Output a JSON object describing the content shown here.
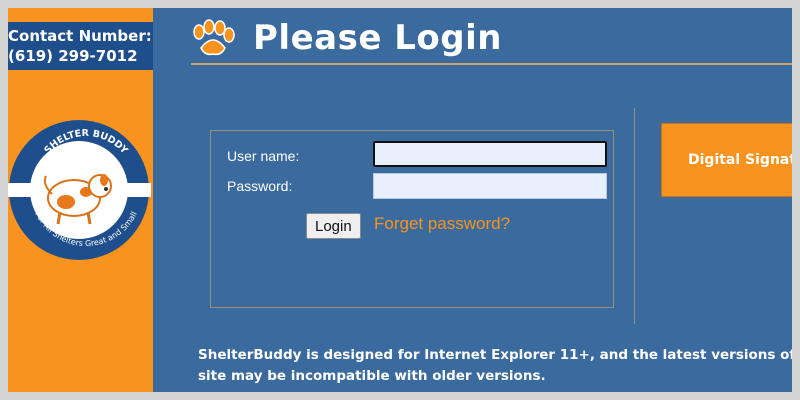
{
  "sidebar": {
    "contact_label": "Contact Number:",
    "contact_phone": "(619) 299-7012",
    "logo": {
      "top_text": "SHELTER BUDDY",
      "bottom_text": "For All Shelters Great and Small"
    }
  },
  "header": {
    "title": "Please Login",
    "icon": "paw-icon"
  },
  "login_form": {
    "username_label": "User name:",
    "username_value": "",
    "password_label": "Password:",
    "password_value": "",
    "login_button": "Login",
    "forgot_link": "Forget password?"
  },
  "signature": {
    "label": "Digital Signature"
  },
  "footer": {
    "line1": "ShelterBuddy is designed for Internet Explorer 11+, and the latest versions of Firefox",
    "line2": "site may be incompatible with older versions."
  },
  "colors": {
    "main_bg": "#3b6b9e",
    "accent_orange": "#f7931e",
    "contact_bg": "#1f4e8c",
    "input_bg": "#e8f0fe"
  }
}
